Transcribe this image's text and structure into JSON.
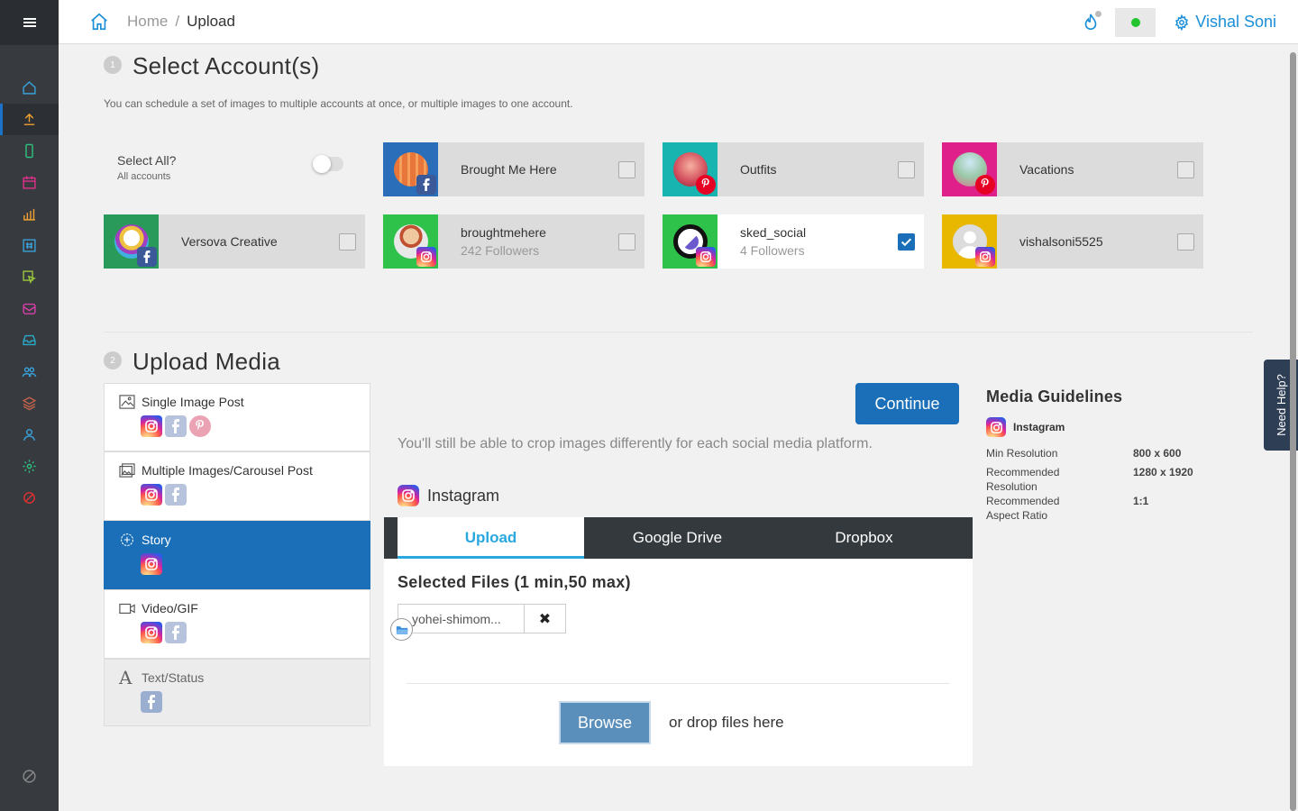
{
  "topbar": {
    "breadcrumb_home": "Home",
    "breadcrumb_sep": "/",
    "breadcrumb_current": "Upload",
    "user_name": "Vishal Soni",
    "status_color": "#22c52d"
  },
  "sidebar": {
    "items": [
      {
        "icon": "home-icon",
        "color": "#3aa0d8"
      },
      {
        "icon": "upload-icon",
        "color": "#f0a030"
      },
      {
        "icon": "mobile-icon",
        "color": "#2ec27e"
      },
      {
        "icon": "calendar-icon",
        "color": "#e0308a"
      },
      {
        "icon": "chart-icon",
        "color": "#f0a030"
      },
      {
        "icon": "hashtag-icon",
        "color": "#3aa0d8"
      },
      {
        "icon": "cursor-icon",
        "color": "#9bc53d"
      },
      {
        "icon": "inbox-icon",
        "color": "#d63fa8"
      },
      {
        "icon": "tray-icon",
        "color": "#2aa8c8"
      },
      {
        "icon": "users-icon",
        "color": "#3aa0d8"
      },
      {
        "icon": "layers-icon",
        "color": "#c0624a"
      },
      {
        "icon": "user-icon",
        "color": "#3aa0d8"
      },
      {
        "icon": "gear-icon",
        "color": "#2ec27e"
      },
      {
        "icon": "block-icon",
        "color": "#e03030"
      }
    ]
  },
  "step1": {
    "num": "1",
    "title": "Select Account(s)",
    "description": "You can schedule a set of images to multiple accounts at once, or multiple images to one account.",
    "select_all_label": "Select All?",
    "select_all_sub": "All accounts"
  },
  "accounts": [
    {
      "name": "Brought Me Here",
      "followers": "",
      "network": "facebook",
      "tile_color": "#2a6db8",
      "checked": false
    },
    {
      "name": "Outfits",
      "followers": "",
      "network": "pinterest",
      "tile_color": "#18b5b0",
      "checked": false
    },
    {
      "name": "Vacations",
      "followers": "",
      "network": "pinterest",
      "tile_color": "#e0208a",
      "checked": false
    },
    {
      "name": "Versova Creative",
      "followers": "",
      "network": "facebook",
      "tile_color": "#2a9a5a",
      "checked": false
    },
    {
      "name": "broughtmehere",
      "followers": "242 Followers",
      "network": "instagram",
      "tile_color": "#2ec24a",
      "checked": false
    },
    {
      "name": "sked_social",
      "followers": "4 Followers",
      "network": "instagram",
      "tile_color": "#2ec24a",
      "checked": true
    },
    {
      "name": "vishalsoni5525",
      "followers": "",
      "network": "instagram",
      "tile_color": "#e8b800",
      "checked": false
    }
  ],
  "step2": {
    "num": "2",
    "title": "Upload Media"
  },
  "post_types": [
    {
      "label": "Single Image Post",
      "icon": "image-icon",
      "networks": [
        "instagram",
        "facebook",
        "pinterest"
      ]
    },
    {
      "label": "Multiple Images/Carousel Post",
      "icon": "images-icon",
      "networks": [
        "instagram",
        "facebook"
      ]
    },
    {
      "label": "Story",
      "icon": "plus-circle-icon",
      "networks": [
        "instagram"
      ]
    },
    {
      "label": "Video/GIF",
      "icon": "video-icon",
      "networks": [
        "instagram",
        "facebook"
      ]
    },
    {
      "label": "Text/Status",
      "icon": "text-icon",
      "networks": [
        "facebook"
      ]
    }
  ],
  "upload": {
    "continue_label": "Continue",
    "crop_note": "You'll still be able to crop images differently for each social media platform.",
    "platform": "Instagram",
    "tabs": [
      "Upload",
      "Google Drive",
      "Dropbox"
    ],
    "selected_title": "Selected Files (1 min,50 max)",
    "file_name": "yohei-shimom...",
    "browse_label": "Browse",
    "drop_label": "or drop files here"
  },
  "guidelines": {
    "title": "Media Guidelines",
    "platform": "Instagram",
    "rows": [
      {
        "key": "Min Resolution",
        "value": "800 x 600"
      },
      {
        "key": "Recommended Resolution",
        "value": "1280 x 1920"
      },
      {
        "key": "Recommended Aspect Ratio",
        "value": "1:1"
      }
    ]
  },
  "help_label": "Need Help?"
}
